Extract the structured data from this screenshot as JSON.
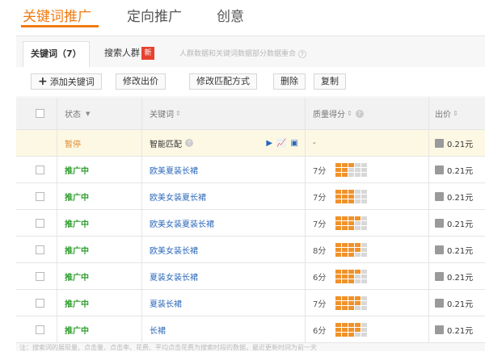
{
  "topnav": {
    "tabs": [
      {
        "label": "关键词推广",
        "active": true
      },
      {
        "label": "定向推广",
        "active": false
      },
      {
        "label": "创意",
        "active": false
      }
    ]
  },
  "subtabs": {
    "keywords_label": "关键词（7）",
    "crowd_label": "搜索人群",
    "new_badge": "新",
    "hint": "人群数据和关键词数据部分数据重合"
  },
  "toolbar": {
    "add_label": "添加关键词",
    "modify_bid_label": "修改出价",
    "modify_match_label": "修改匹配方式",
    "delete_label": "删除",
    "copy_label": "复制"
  },
  "table": {
    "headers": {
      "status": "状态",
      "keyword": "关键词",
      "quality": "质量得分",
      "bid": "出价"
    },
    "rows": [
      {
        "status": "暂停",
        "keyword": "智能匹配",
        "score": "-",
        "quality_level": 0,
        "price": "0.21元",
        "special": true
      },
      {
        "status": "推广中",
        "keyword": "欧美夏装长裙",
        "score": "7分",
        "quality_level": 7,
        "price": "0.21元"
      },
      {
        "status": "推广中",
        "keyword": "欧美女装夏长裙",
        "score": "7分",
        "quality_level": 9,
        "price": "0.21元"
      },
      {
        "status": "推广中",
        "keyword": "欧美女装夏装长裙",
        "score": "7分",
        "quality_level": 10,
        "price": "0.21元"
      },
      {
        "status": "推广中",
        "keyword": "欧美女装长裙",
        "score": "8分",
        "quality_level": 11,
        "price": "0.21元"
      },
      {
        "status": "推广中",
        "keyword": "夏装女装长裙",
        "score": "6分",
        "quality_level": 10,
        "price": "0.21元"
      },
      {
        "status": "推广中",
        "keyword": "夏装长裙",
        "score": "7分",
        "quality_level": 11,
        "price": "0.21元"
      },
      {
        "status": "推广中",
        "keyword": "长裙",
        "score": "6分",
        "quality_level": 11,
        "price": "0.21元"
      }
    ]
  },
  "footer": "注：搜索词的展现量、点击量、点击率、花费、平均点击花费为搜索时段的数据，最近更新时间为前一天"
}
